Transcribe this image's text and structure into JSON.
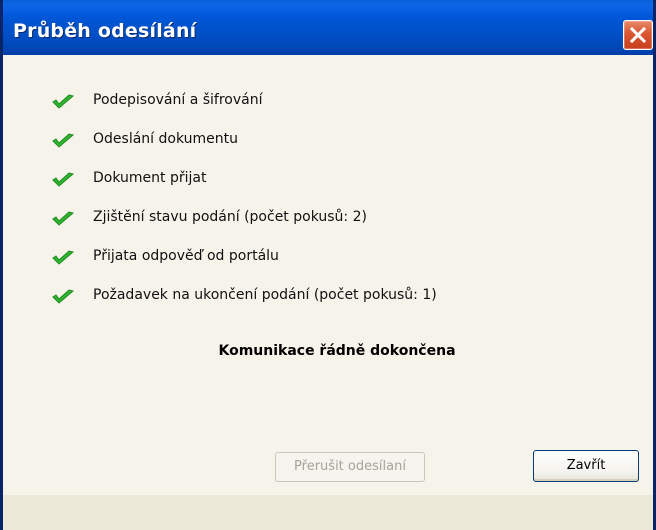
{
  "window": {
    "title": "Průběh odesílání",
    "accent_color": "#0054e3",
    "close_icon": "close-icon"
  },
  "steps": [
    {
      "label": "Podepisování a šifrování",
      "status": "done",
      "icon": "check-icon",
      "color": "#2bb32b"
    },
    {
      "label": "Odeslání dokumentu",
      "status": "done",
      "icon": "check-icon",
      "color": "#2bb32b"
    },
    {
      "label": "Dokument přijat",
      "status": "done",
      "icon": "check-icon",
      "color": "#2bb32b"
    },
    {
      "label": "Zjištění stavu podání (počet pokusů: 2)",
      "status": "done",
      "icon": "check-icon",
      "color": "#2bb32b"
    },
    {
      "label": "Přijata odpověď od portálu",
      "status": "done",
      "icon": "check-icon",
      "color": "#2bb32b"
    },
    {
      "label": "Požadavek na ukončení podání (počet pokusů: 1)",
      "status": "done",
      "icon": "check-icon",
      "color": "#2bb32b"
    }
  ],
  "completion_message": "Komunikace řádně dokončena",
  "buttons": {
    "abort_label": "Přerušit odesílaní",
    "abort_enabled": false,
    "close_label": "Zavřít"
  }
}
